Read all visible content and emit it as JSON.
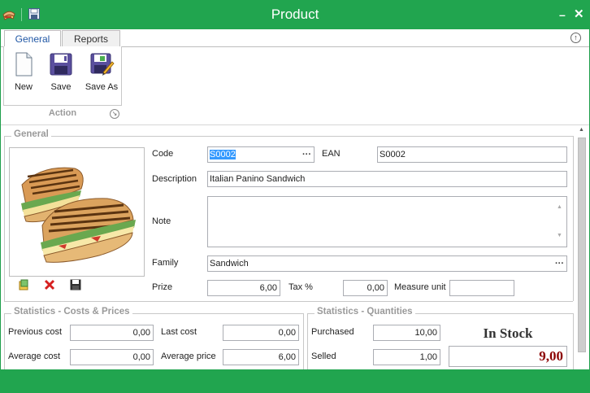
{
  "window": {
    "title": "Product",
    "app_icon": "sandwich-app-icon",
    "save_icon": "floppy-disk-icon",
    "minimize_label": "–",
    "close_label": "✕"
  },
  "ribbon": {
    "tabs": [
      {
        "label": "General",
        "active": true
      },
      {
        "label": "Reports",
        "active": false
      }
    ],
    "collapse_icon": "↑",
    "group": {
      "label": "Action",
      "launcher_icon": "↘",
      "buttons": [
        {
          "label": "New",
          "icon": "new-document-icon"
        },
        {
          "label": "Save",
          "icon": "save-icon"
        },
        {
          "label": "Save As",
          "icon": "save-as-icon"
        }
      ]
    }
  },
  "general": {
    "section_title": "General",
    "image_tools": [
      "open-image-icon",
      "delete-image-icon",
      "save-image-icon"
    ],
    "code_label": "Code",
    "code_value": "S0002",
    "ean_label": "EAN",
    "ean_value": "S0002",
    "description_label": "Description",
    "description_value": "Italian Panino Sandwich",
    "note_label": "Note",
    "note_value": "",
    "family_label": "Family",
    "family_value": "Sandwich",
    "prize_label": "Prize",
    "prize_value": "6,00",
    "tax_label": "Tax %",
    "tax_value": "0,00",
    "measure_label": "Measure unit",
    "measure_value": "",
    "ellipsis": "···"
  },
  "costs": {
    "section_title": "Statistics - Costs & Prices",
    "previous_cost_label": "Previous cost",
    "previous_cost_value": "0,00",
    "last_cost_label": "Last cost",
    "last_cost_value": "0,00",
    "average_cost_label": "Average cost",
    "average_cost_value": "0,00",
    "average_price_label": "Average price",
    "average_price_value": "6,00"
  },
  "quantities": {
    "section_title": "Statistics - Quantities",
    "purchased_label": "Purchased",
    "purchased_value": "10,00",
    "selled_label": "Selled",
    "selled_value": "1,00",
    "stock_title": "In Stock",
    "stock_value": "9,00"
  }
}
